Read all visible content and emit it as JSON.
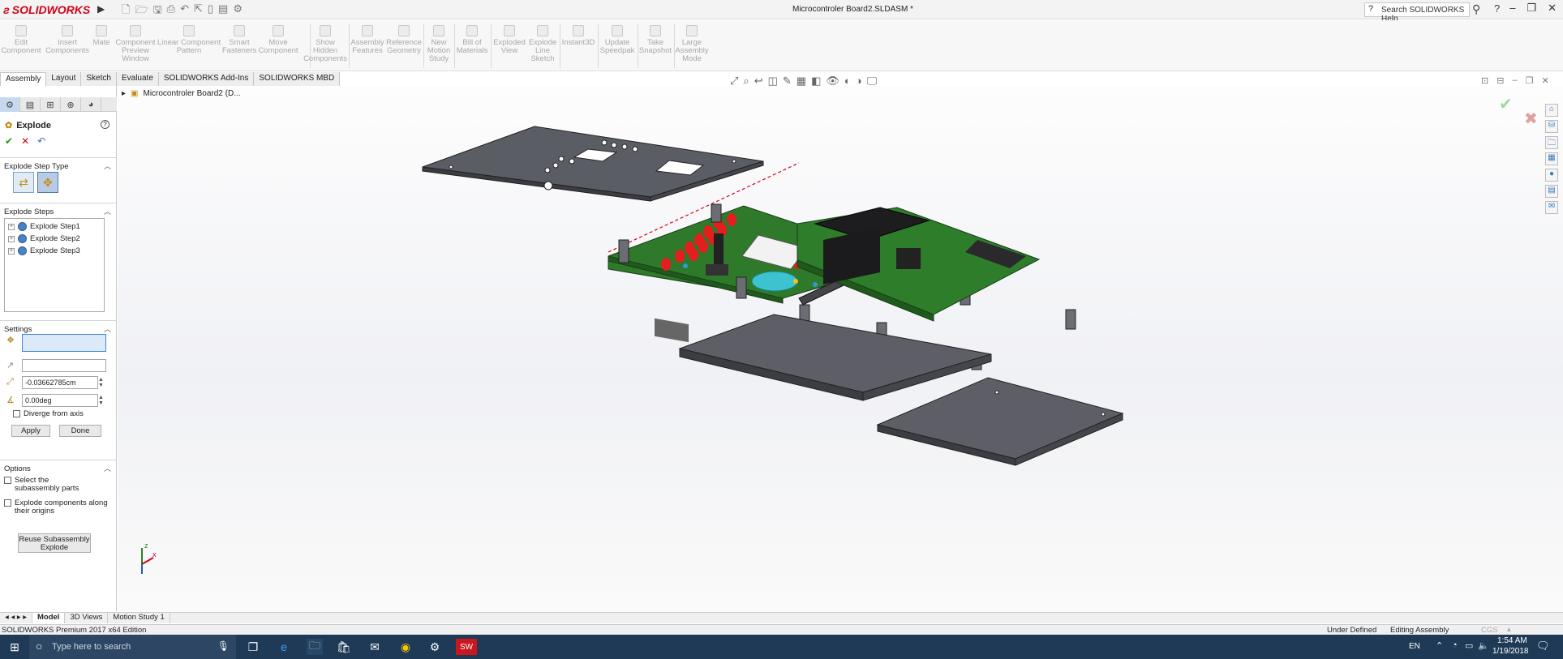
{
  "app": {
    "brand": "SOLIDWORKS",
    "doc_title": "Microcontroler Board2.SLDASM *"
  },
  "help": {
    "search_placeholder": "Search SOLIDWORKS Help",
    "help_icon": "?"
  },
  "commands": [
    {
      "label": "Edit\nComponent"
    },
    {
      "label": "Insert\nComponents"
    },
    {
      "label": "Mate"
    },
    {
      "label": "Component\nPreview\nWindow"
    },
    {
      "label": "Linear Component\nPattern"
    },
    {
      "label": "Smart\nFasteners"
    },
    {
      "label": "Move\nComponent"
    },
    {
      "label": "Show\nHidden\nComponents"
    },
    {
      "label": "Assembly\nFeatures"
    },
    {
      "label": "Reference\nGeometry"
    },
    {
      "label": "New\nMotion\nStudy"
    },
    {
      "label": "Bill of\nMaterials"
    },
    {
      "label": "Exploded\nView"
    },
    {
      "label": "Explode\nLine\nSketch"
    },
    {
      "label": "Instant3D"
    },
    {
      "label": "Update\nSpeedpak"
    },
    {
      "label": "Take\nSnapshot"
    },
    {
      "label": "Large\nAssembly\nMode"
    }
  ],
  "cmd_tabs": [
    "Assembly",
    "Layout",
    "Sketch",
    "Evaluate",
    "SOLIDWORKS Add-Ins",
    "SOLIDWORKS MBD"
  ],
  "tree": {
    "root_label": "Microcontroler Board2  (D..."
  },
  "property_manager": {
    "title": "Explode",
    "sections": {
      "step_type": "Explode Step Type",
      "steps": "Explode Steps",
      "settings": "Settings",
      "options": "Options"
    },
    "steps": [
      "Explode Step1",
      "Explode Step2",
      "Explode Step3"
    ],
    "distance": "-0.03662785cm",
    "angle": "0.00deg",
    "diverge_label": "Diverge from axis",
    "apply_label": "Apply",
    "done_label": "Done",
    "opt1": "Select the subassembly parts",
    "opt2": "Explode components along their origins",
    "reuse_label": "Reuse Subassembly Explode"
  },
  "bottom_tabs": [
    "Model",
    "3D Views",
    "Motion Study 1"
  ],
  "status": {
    "edition": "SOLIDWORKS Premium 2017 x64 Edition",
    "state": "Under Defined",
    "mode": "Editing Assembly",
    "units": "CGS"
  },
  "taskbar": {
    "search_placeholder": "Type here to search",
    "lang": "EN",
    "time": "1:54 AM",
    "date": "1/19/2018"
  },
  "colors": {
    "pcb": "#2f7a2a",
    "plate": "#5e5f66",
    "accent": "#d0021b",
    "taskbar": "#1f3a56"
  }
}
